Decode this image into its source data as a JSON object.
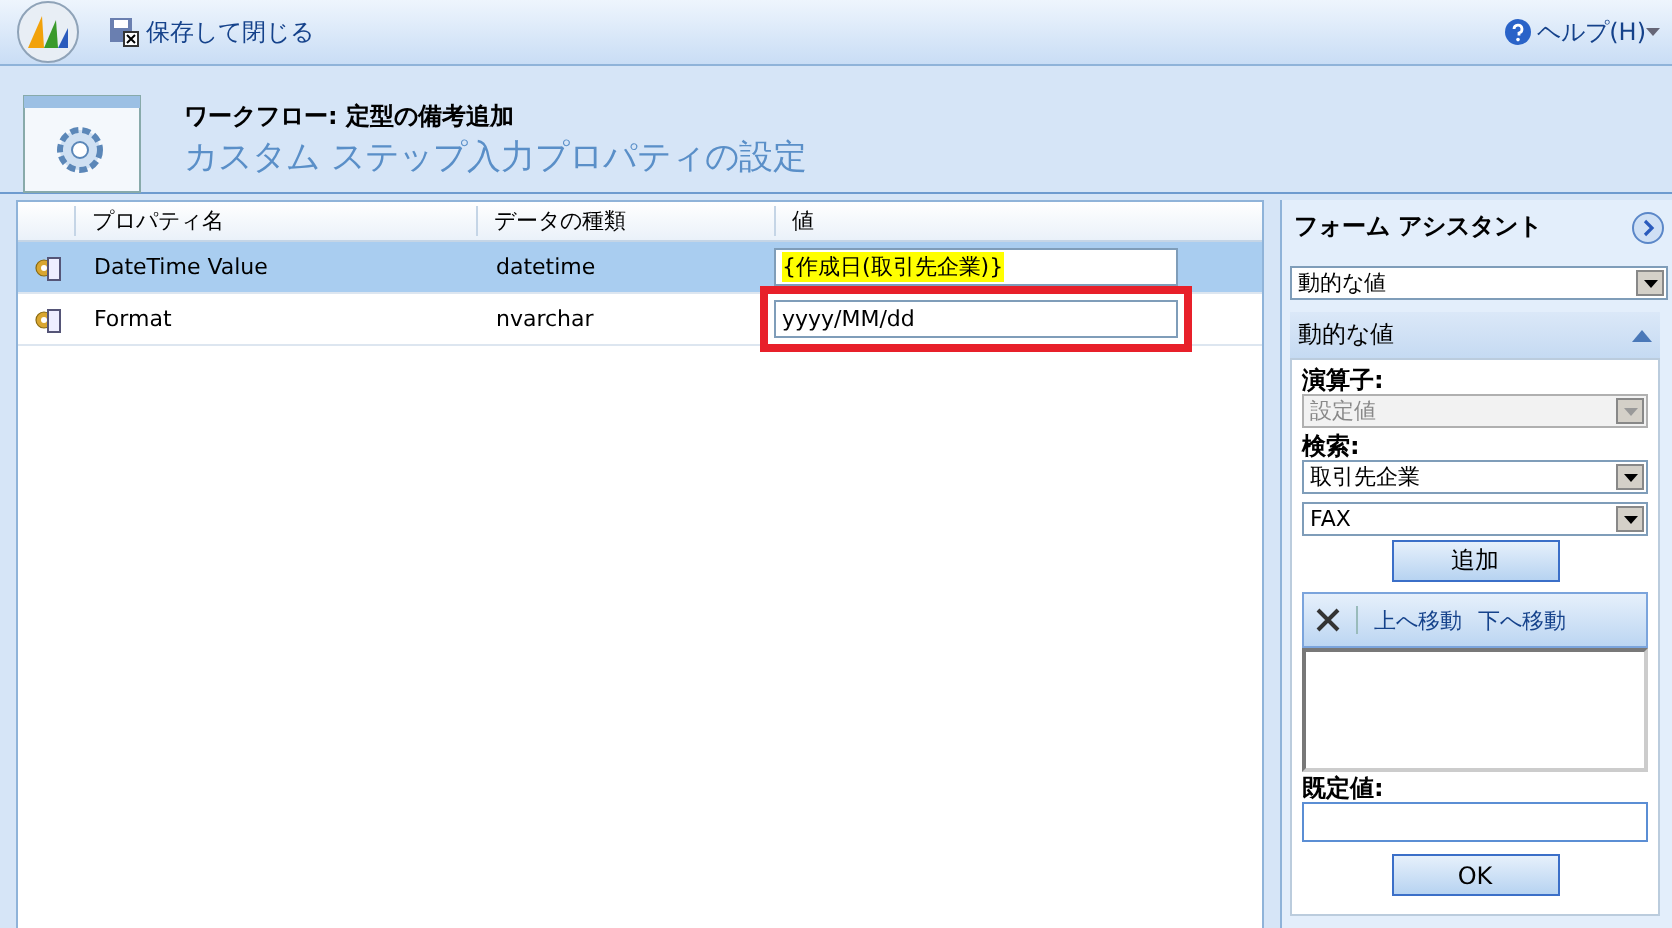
{
  "toolbar": {
    "save_close": "保存して閉じる",
    "help": "ヘルプ(H)"
  },
  "header": {
    "subtitle": "ワークフロー: 定型の備考追加",
    "title": "カスタム ステップ入力プロパティの設定"
  },
  "grid": {
    "columns": [
      "プロパティ名",
      "データの種類",
      "値"
    ],
    "rows": [
      {
        "name": "DateTime Value",
        "type": "datetime",
        "value": "{作成日(取引先企業)}",
        "kind": "dynamic",
        "selected": true,
        "highlighted": false
      },
      {
        "name": "Format",
        "type": "nvarchar",
        "value": "yyyy/MM/dd",
        "kind": "text",
        "selected": false,
        "highlighted": true
      }
    ]
  },
  "assistant": {
    "title": "フォーム アシスタント",
    "mode": "動的な値",
    "section": {
      "title": "動的な値",
      "expanded": true
    },
    "operator_label": "演算子:",
    "operator": {
      "value": "設定値",
      "disabled": true
    },
    "lookup_label": "検索:",
    "lookup": "取引先企業",
    "field": "FAX",
    "add": "追加",
    "list_tools": [
      "上へ移動",
      "下へ移動"
    ],
    "default_label": "既定値:",
    "ok": "OK"
  }
}
